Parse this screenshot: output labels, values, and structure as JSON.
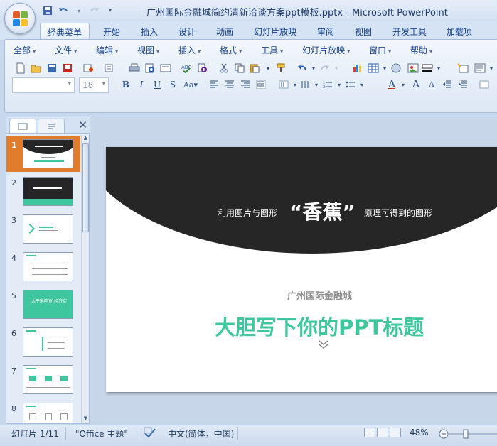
{
  "window": {
    "title": "广州国际金融城简约清新洽谈方案ppt模板.pptx - Microsoft PowerPoint"
  },
  "ribbon": {
    "tabs": [
      "经典菜单",
      "开始",
      "插入",
      "设计",
      "动画",
      "幻灯片放映",
      "审阅",
      "视图",
      "开发工具",
      "加载项"
    ],
    "active_tab": "经典菜单",
    "menus": [
      "全部",
      "文件",
      "编辑",
      "视图",
      "插入",
      "格式",
      "工具",
      "幻灯片放映",
      "窗口",
      "帮助"
    ],
    "font_name_value": "",
    "font_size_value": "18"
  },
  "thumbnails": {
    "numbers": [
      "1",
      "2",
      "3",
      "4",
      "5",
      "6",
      "7",
      "8"
    ],
    "selected": "1",
    "slide5_text": "太平影响宣 经济实"
  },
  "slide": {
    "subtitle_left": "利用图片与图形",
    "highlight": "“香蕉”",
    "subtitle_right": "原理可得到的图形",
    "company": "广州国际金融城",
    "title": "大胆写下你的PPT标题"
  },
  "status": {
    "slide_info": "幻灯片 1/11",
    "theme": "\"Office 主题\"",
    "language": "中文(简体，中国)",
    "zoom": "48%"
  },
  "colors": {
    "accent_green": "#3ec79e",
    "slide_dark": "#262626",
    "selection_orange": "#e07c2c"
  }
}
